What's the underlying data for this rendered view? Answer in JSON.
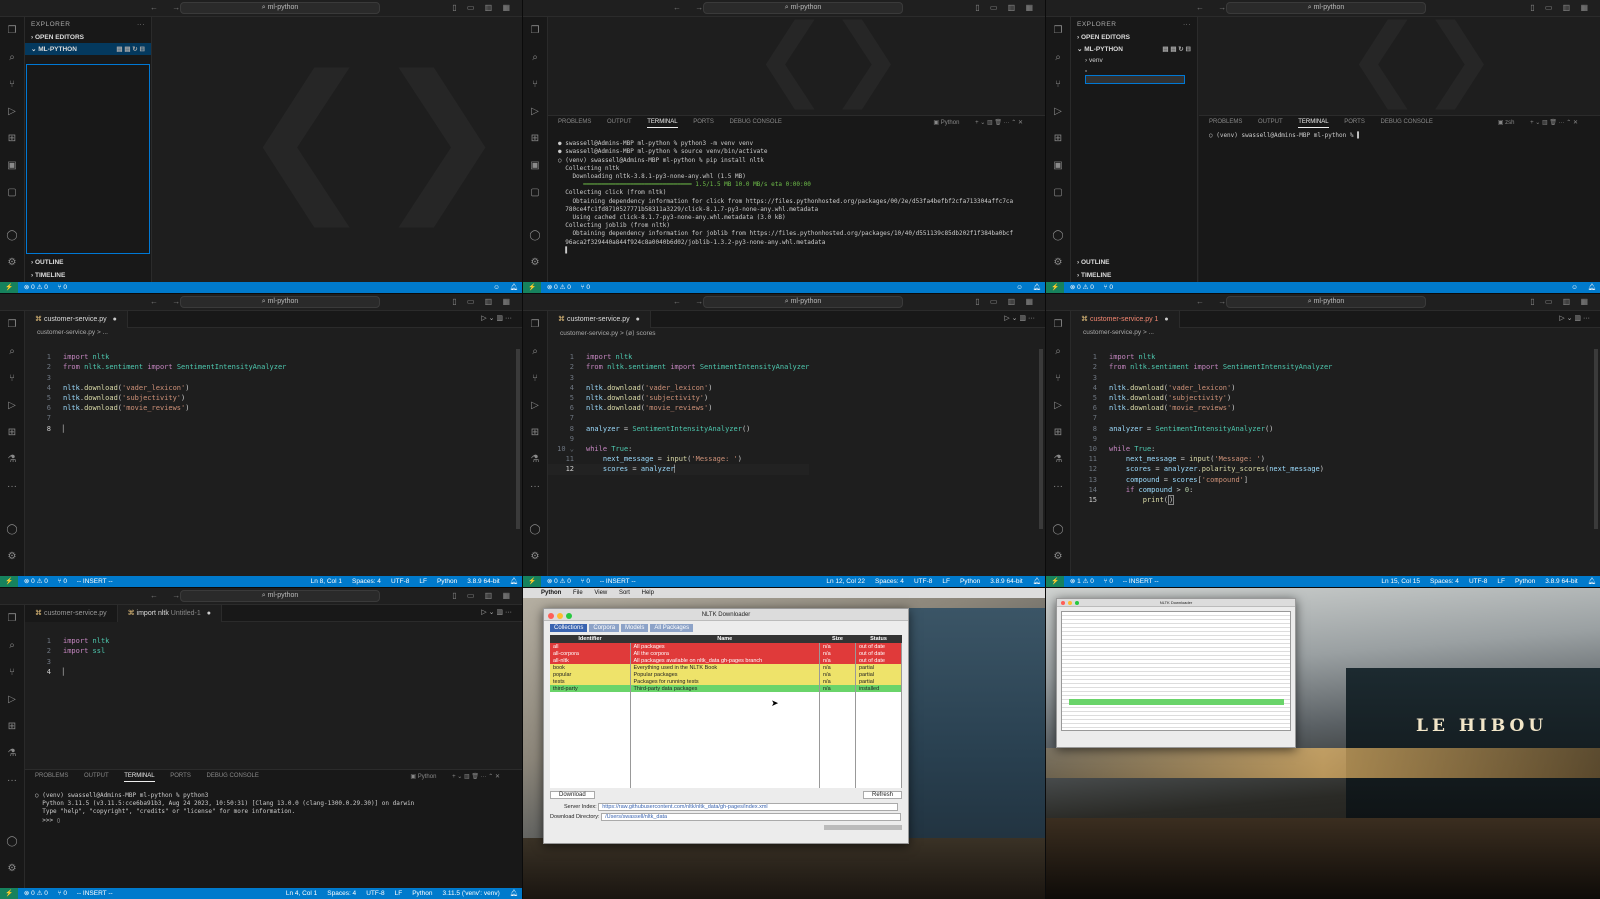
{
  "common": {
    "window_title": "ml-python",
    "status_remote": "⚡",
    "status_problems": "⊗ 0 ⚠ 0",
    "status_ports": "⑂ 0",
    "insert_mode": "-- INSERT --"
  },
  "p1": {
    "explorer_title": "EXPLORER",
    "open_editors": "OPEN EDITORS",
    "folder": "ML-PYTHON",
    "outline": "OUTLINE",
    "timeline": "TIMELINE"
  },
  "p2": {
    "panel_tabs": [
      "PROBLEMS",
      "OUTPUT",
      "TERMINAL",
      "PORTS",
      "DEBUG CONSOLE"
    ],
    "term_label": "Python",
    "terminal": [
      "● swassell@Admins-MBP ml-python % python3 -m venv venv",
      "● swassell@Admins-MBP ml-python % source venv/bin/activate",
      "○ (venv) swassell@Admins-MBP ml-python % pip install nltk",
      "  Collecting nltk",
      "    Downloading nltk-3.8.1-py3-none-any.whl (1.5 MB)",
      "       ━━━━━━━━━━━━━━━━━━━━━━━━━━━━━━ 1.5/1.5 MB 10.0 MB/s eta 0:00:00",
      "  Collecting click (from nltk)",
      "    Obtaining dependency information for click from https://files.pythonhosted.org/packages/00/2e/d53fa4befbf2cfa713304affc7ca",
      "  780ce4fc1fd8710527771b58311a3229/click-8.1.7-py3-none-any.whl.metadata",
      "    Using cached click-8.1.7-py3-none-any.whl.metadata (3.0 kB)",
      "  Collecting joblib (from nltk)",
      "    Obtaining dependency information for joblib from https://files.pythonhosted.org/packages/10/40/d551139c85db202f1f384ba0bcf",
      "  96aca2f329440a844f924c8a0040b6d02/joblib-1.3.2-py3-none-any.whl.metadata",
      "  ▌"
    ]
  },
  "p3": {
    "explorer_title": "EXPLORER",
    "open_editors": "OPEN EDITORS",
    "folder": "ML-PYTHON",
    "venv": "venv",
    "outline": "OUTLINE",
    "timeline": "TIMELINE",
    "panel_tabs": [
      "PROBLEMS",
      "OUTPUT",
      "TERMINAL",
      "PORTS",
      "DEBUG CONSOLE"
    ],
    "term_label": "zsh",
    "terminal": [
      "○ (venv) swassell@Admins-MBP ml-python % ▌"
    ]
  },
  "p4": {
    "tab": "customer-service.py",
    "crumb": "customer-service.py > ...",
    "status_pos": "Ln 8, Col 1",
    "status_spaces": "Spaces: 4",
    "status_enc": "UTF-8",
    "status_eol": "LF",
    "status_lang": "Python",
    "status_interp": "3.8.9 64-bit"
  },
  "p5": {
    "tab": "customer-service.py",
    "crumb": "customer-service.py > ⟨ø⟩ scores",
    "status_pos": "Ln 12, Col 22",
    "status_spaces": "Spaces: 4",
    "status_enc": "UTF-8",
    "status_eol": "LF",
    "status_lang": "Python",
    "status_interp": "3.8.9 64-bit"
  },
  "p6": {
    "tab": "customer-service.py 1",
    "crumb": "customer-service.py > ...",
    "status_problems": "⊗ 1 ⚠ 0",
    "status_pos": "Ln 15, Col 15",
    "status_spaces": "Spaces: 4",
    "status_enc": "UTF-8",
    "status_eol": "LF",
    "status_lang": "Python",
    "status_interp": "3.8.9 64-bit"
  },
  "p7": {
    "tab1": "customer-service.py",
    "tab2": "import nltk",
    "tab2_sub": "Untitled-1",
    "panel_tabs": [
      "PROBLEMS",
      "OUTPUT",
      "TERMINAL",
      "PORTS",
      "DEBUG CONSOLE"
    ],
    "term_label": "Python",
    "terminal": [
      "○ (venv) swassell@Admins-MBP ml-python % python3",
      "  Python 3.11.5 (v3.11.5:cce6ba91b3, Aug 24 2023, 10:50:31) [Clang 13.0.0 (clang-1300.0.29.30)] on darwin",
      "  Type \"help\", \"copyright\", \"credits\" or \"license\" for more information.",
      "  >>> ▯"
    ],
    "status_pos": "Ln 4, Col 1",
    "status_spaces": "Spaces: 4",
    "status_enc": "UTF-8",
    "status_eol": "LF",
    "status_lang": "Python",
    "status_interp": "3.11.5 ('venv': venv)"
  },
  "p8": {
    "menu": [
      "Python",
      "File",
      "View",
      "Sort",
      "Help"
    ],
    "dialog_title": "NLTK Downloader",
    "tabs": [
      "Collections",
      "Corpora",
      "Models",
      "All Packages"
    ],
    "headers": [
      "Identifier",
      "Name",
      "Size",
      "Status"
    ],
    "rows": [
      {
        "id": "all",
        "name": "All packages",
        "size": "n/a",
        "status": "out of date",
        "c": "red"
      },
      {
        "id": "all-corpora",
        "name": "All the corpora",
        "size": "n/a",
        "status": "out of date",
        "c": "red"
      },
      {
        "id": "all-nltk",
        "name": "All packages available on nltk_data gh-pages branch",
        "size": "n/a",
        "status": "out of date",
        "c": "red"
      },
      {
        "id": "book",
        "name": "Everything used in the NLTK Book",
        "size": "n/a",
        "status": "partial",
        "c": "yel"
      },
      {
        "id": "popular",
        "name": "Popular packages",
        "size": "n/a",
        "status": "partial",
        "c": "yel"
      },
      {
        "id": "tests",
        "name": "Packages for running tests",
        "size": "n/a",
        "status": "partial",
        "c": "yel"
      },
      {
        "id": "third-party",
        "name": "Third-party data packages",
        "size": "n/a",
        "status": "installed",
        "c": "grn"
      }
    ],
    "download": "Download",
    "refresh": "Refresh",
    "server_label": "Server Index:",
    "server_value": "https://raw.githubusercontent.com/nltk/nltk_data/gh-pages/index.xml",
    "dir_label": "Download Directory:",
    "dir_value": "/Users/swassell/nltk_data"
  },
  "p9": {
    "dialog_title": "NLTK Downloader",
    "sign": "LE HIBOU"
  }
}
